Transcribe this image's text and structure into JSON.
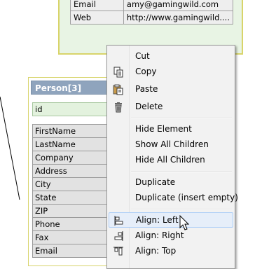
{
  "top_table": {
    "rows": [
      {
        "key": "Email",
        "value": "amy@gamingwild.com"
      },
      {
        "key": "Web",
        "value": "http://www.gamingwild...."
      }
    ]
  },
  "entity": {
    "title": "Person[3]",
    "primary_key": "id",
    "fields": [
      "FirstName",
      "LastName",
      "Company",
      "Address",
      "City",
      "State",
      "ZIP",
      "Phone",
      "Fax",
      "Email"
    ]
  },
  "context_menu": {
    "items": [
      {
        "label": "Cut",
        "icon": "cut-icon"
      },
      {
        "label": "Copy",
        "icon": "copy-icon"
      },
      {
        "label": "Paste",
        "icon": "paste-icon"
      },
      {
        "label": "Delete",
        "icon": "trash-icon"
      },
      {
        "label": "Hide Element"
      },
      {
        "label": "Show All Children"
      },
      {
        "label": "Hide All Children"
      },
      {
        "label": "Duplicate"
      },
      {
        "label": "Duplicate (insert empty)"
      },
      {
        "label": "Align: Left",
        "icon": "align-left-icon",
        "highlighted": true
      },
      {
        "label": "Align: Right",
        "icon": "align-right-icon"
      },
      {
        "label": "Align: Top",
        "icon": "align-top-icon"
      }
    ]
  },
  "colors": {
    "entity_header": "#8fa4bd",
    "entity_border": "#d8d46a",
    "pk_background": "#e3f2de",
    "menu_highlight": "#e6eef9"
  }
}
